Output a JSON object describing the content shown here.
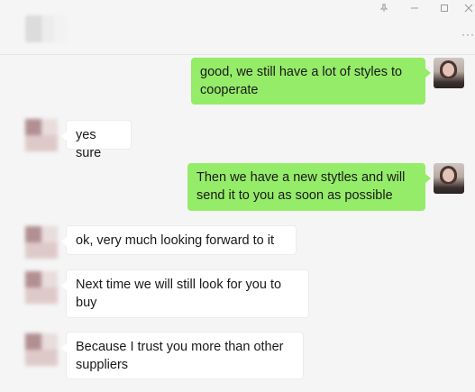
{
  "window": {
    "pin_icon": "pin-icon",
    "minimize_icon": "minimize-icon",
    "maximize_icon": "maximize-icon",
    "close_icon": "close-icon",
    "more_icon": "more-icon"
  },
  "messages": [
    {
      "side": "out",
      "lines": [
        "good, we still have a lot of styles to",
        "cooperate"
      ]
    },
    {
      "side": "in",
      "lines": [
        "yes sure"
      ]
    },
    {
      "side": "out",
      "lines": [
        "Then we have a new stytles and will",
        "send it to you as soon as possible"
      ]
    },
    {
      "side": "in",
      "lines": [
        "ok, very much looking forward to it"
      ]
    },
    {
      "side": "in",
      "lines": [
        "Next time we will still look for you to",
        "buy"
      ]
    },
    {
      "side": "in",
      "lines": [
        "Because I trust you more than other",
        "suppliers"
      ]
    }
  ],
  "colors": {
    "outgoing_bubble": "#95ec69",
    "incoming_bubble": "#ffffff",
    "background": "#f5f5f5"
  }
}
